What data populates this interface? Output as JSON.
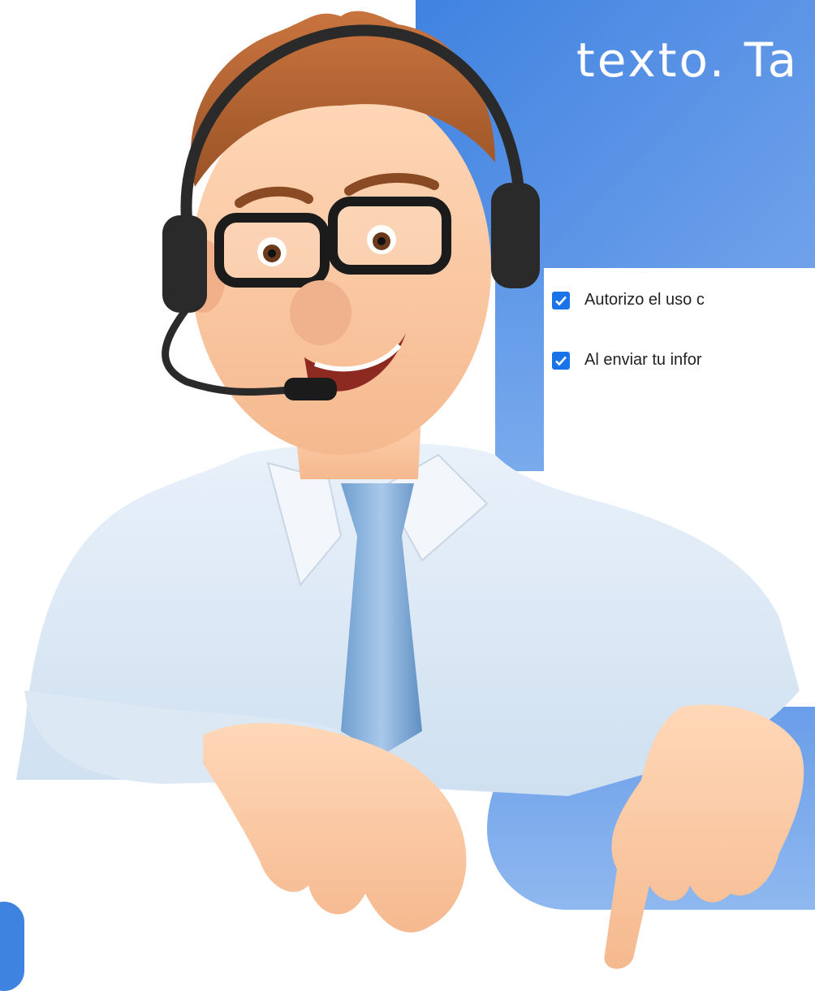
{
  "headline": "texto. Ta",
  "consent": {
    "items": [
      {
        "label": "Autorizo el uso c",
        "checked": true
      },
      {
        "label": "Al enviar tu infor",
        "checked": true
      }
    ]
  },
  "colors": {
    "accent": "#3f83e0",
    "checkbox": "#1a73e8"
  },
  "illustration": {
    "icon": "support-agent-icon"
  }
}
